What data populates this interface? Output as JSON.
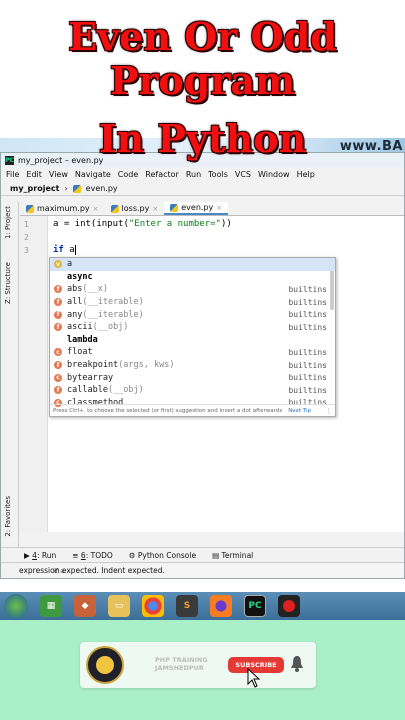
{
  "overlay": {
    "title_line1": "Even Or Odd",
    "title_line2": "Program",
    "title_line3": "In Python",
    "watermark": "www.BA"
  },
  "window": {
    "title": "my_project – even.py",
    "icon": "PC"
  },
  "menu": [
    "File",
    "Edit",
    "View",
    "Navigate",
    "Code",
    "Refactor",
    "Run",
    "Tools",
    "VCS",
    "Window",
    "Help"
  ],
  "breadcrumb": {
    "project": "my_project",
    "file": "even.py"
  },
  "tabs": [
    {
      "label": "maximum.py",
      "active": false
    },
    {
      "label": "loss.py",
      "active": false
    },
    {
      "label": "even.py",
      "active": true
    }
  ],
  "left_tool_tabs": [
    "1: Project",
    "Z: Structure",
    "2: Favorites"
  ],
  "editor": {
    "line_numbers": [
      "1",
      "2",
      "3"
    ],
    "line1_prefix": "a = int(input(",
    "line1_string": "\"Enter a number=\"",
    "line1_suffix": "))",
    "line3_keyword": "if",
    "line3_text": " a"
  },
  "completion": {
    "items": [
      {
        "icon": "v",
        "name": "a",
        "sig": "",
        "source": "",
        "selected": true
      },
      {
        "icon": "",
        "name": "async",
        "sig": "",
        "source": "",
        "keyword": true
      },
      {
        "icon": "f",
        "name": "abs",
        "sig": "(__x)",
        "source": "builtins"
      },
      {
        "icon": "f",
        "name": "all",
        "sig": "(__iterable)",
        "source": "builtins"
      },
      {
        "icon": "f",
        "name": "any",
        "sig": "(__iterable)",
        "source": "builtins"
      },
      {
        "icon": "f",
        "name": "ascii",
        "sig": "(__obj)",
        "source": "builtins"
      },
      {
        "icon": "",
        "name": "lambda",
        "sig": "",
        "source": "",
        "keyword": true
      },
      {
        "icon": "c",
        "name": "float",
        "sig": "",
        "source": "builtins"
      },
      {
        "icon": "f",
        "name": "breakpoint",
        "sig": "(args, kws)",
        "source": "builtins"
      },
      {
        "icon": "c",
        "name": "bytearray",
        "sig": "",
        "source": "builtins"
      },
      {
        "icon": "f",
        "name": "callable",
        "sig": "(__obj)",
        "source": "builtins"
      },
      {
        "icon": "c",
        "name": "classmethod",
        "sig": "",
        "source": "builtins"
      }
    ],
    "footer": "Press Ctrl+. to choose the selected (or first) suggestion and insert a dot afterwards",
    "next_tip": "Next Tip"
  },
  "breadcrumb_status": "if a",
  "tool_windows": [
    {
      "num": "4",
      "label": "Run"
    },
    {
      "num": "6",
      "label": "TODO"
    },
    {
      "num": "",
      "label": "Python Console"
    },
    {
      "num": "",
      "label": "Terminal"
    }
  ],
  "status_message": "expression expected. Indent expected.",
  "taskbar_icons": [
    "start",
    "file-explorer-icon",
    "games-icon",
    "folder-icon",
    "chrome-icon",
    "sublime-icon",
    "firefox-icon",
    "pycharm-icon",
    "record-icon"
  ],
  "subscribe": {
    "brand_line1": "PHP TRAINING",
    "brand_line2": "JAMSHEDPUR",
    "button": "SUBSCRIBE"
  },
  "colors": {
    "title_red": "#f20f0f",
    "subscribe_red": "#e53935",
    "bottom_bg": "#a9f0c9",
    "selection": "#d5e4f7"
  }
}
